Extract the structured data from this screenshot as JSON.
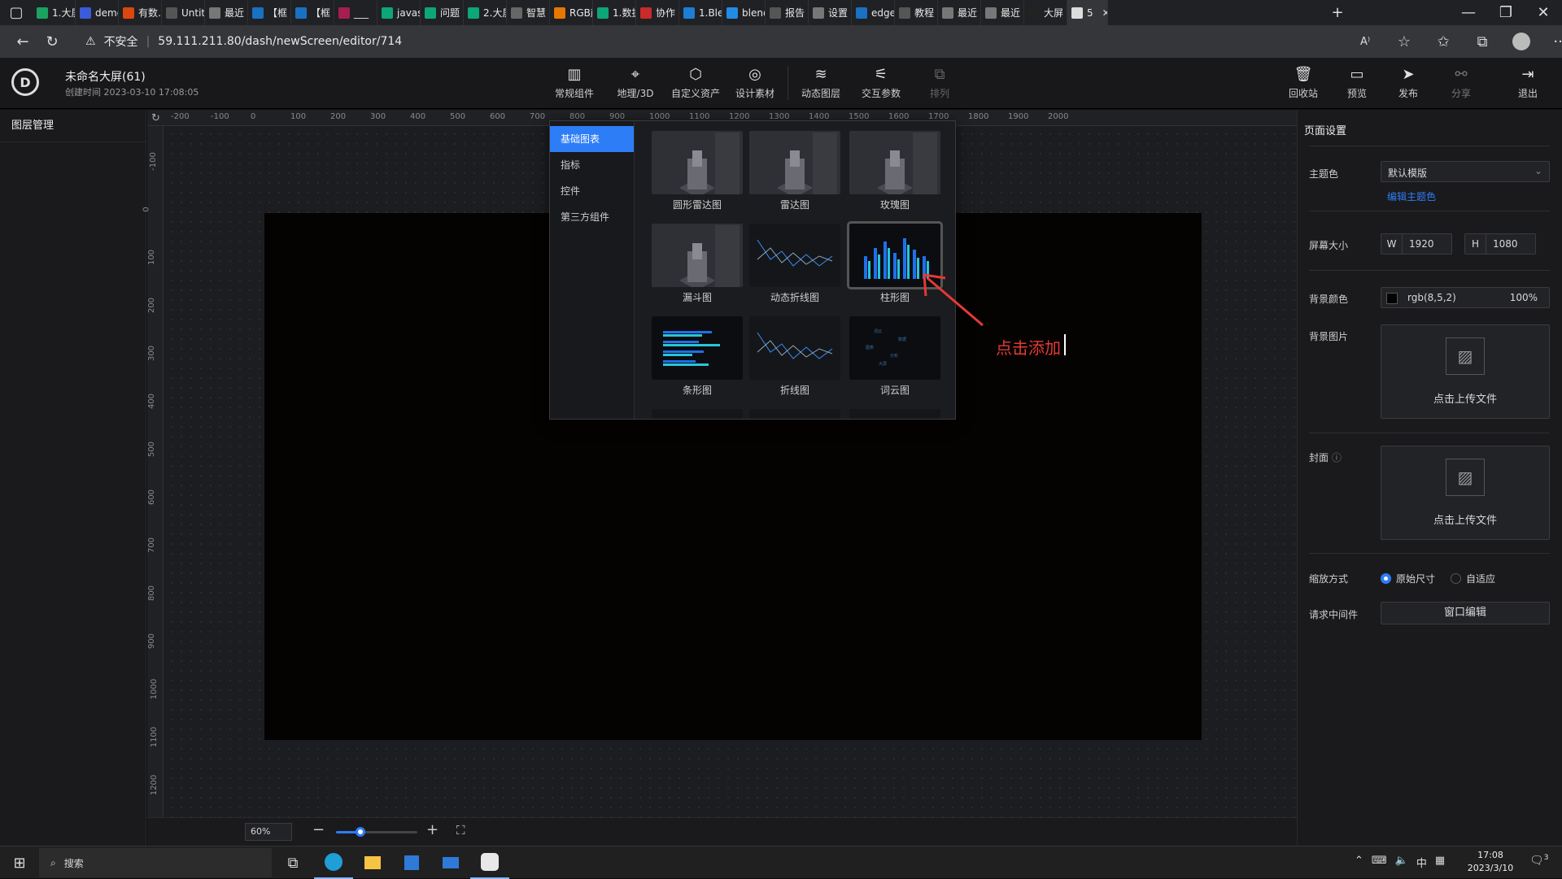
{
  "browser": {
    "tabs": [
      "1.大屏",
      "demo",
      "有数…",
      "Untit",
      "最近",
      "【框",
      "【框",
      "___",
      "javas",
      "问题",
      "2.大屏",
      "智慧",
      "RGB颜",
      "1.数据",
      "协作",
      "1.Ble",
      "blend",
      "报告",
      "设置",
      "edge",
      "教程",
      "最近",
      "最近",
      "大屏",
      "5"
    ],
    "security_label": "不安全",
    "url": "59.111.211.80/dash/newScreen/editor/714"
  },
  "header": {
    "title": "未命名大屏(61)",
    "created": "创建时间 2023-03-10 17:08:05",
    "tools": [
      "常规组件",
      "地理/3D",
      "自定义资产",
      "设计素材",
      "动态图层",
      "交互参数",
      "排列"
    ],
    "right_tools": [
      "回收站",
      "预览",
      "发布",
      "分享",
      "退出"
    ]
  },
  "left_panel": {
    "title": "图层管理"
  },
  "rulers": {
    "top": [
      "-200",
      "-100",
      "0",
      "100",
      "200",
      "300",
      "400",
      "500",
      "600",
      "700",
      "800",
      "900",
      "1000",
      "1100",
      "1200",
      "1300",
      "1400",
      "1500",
      "1600",
      "1700",
      "1800",
      "1900",
      "2000"
    ],
    "left": [
      "-100",
      "0",
      "100",
      "200",
      "300",
      "400",
      "500",
      "600",
      "700",
      "800",
      "900",
      "1000",
      "1100",
      "1200"
    ]
  },
  "popup": {
    "menu": [
      "基础图表",
      "指标",
      "控件",
      "第三方组件"
    ],
    "charts": [
      "圆形雷达图",
      "雷达图",
      "玫瑰图",
      "漏斗图",
      "动态折线图",
      "柱形图",
      "条形图",
      "折线图",
      "词云图"
    ]
  },
  "annotation": {
    "text": "点击添加"
  },
  "right_panel": {
    "title": "页面设置",
    "theme_label": "主题色",
    "theme_value": "默认模版",
    "edit_theme": "编辑主题色",
    "screen_size_label": "屏幕大小",
    "w_label": "W",
    "w_value": "1920",
    "h_label": "H",
    "h_value": "1080",
    "bg_color_label": "背景颜色",
    "bg_color_value": "rgb(8,5,2)",
    "bg_opacity": "100%",
    "bg_image_label": "背景图片",
    "upload_text": "点击上传文件",
    "cover_label": "封面",
    "cover_upload_text": "点击上传文件",
    "scale_label": "缩放方式",
    "scale_options": [
      "原始尺寸",
      "自适应"
    ],
    "middleware_label": "请求中间件",
    "middleware_button": "窗口编辑"
  },
  "bottom": {
    "zoom": "60%",
    "zoom_level": 0.3
  },
  "taskbar": {
    "search": "搜索",
    "ime": "中",
    "time": "17:08",
    "date": "2023/3/10",
    "notif": "3"
  },
  "colors": {
    "accent": "#2d7df6",
    "canvas_bg": "#050302",
    "annotation": "#e53935"
  }
}
